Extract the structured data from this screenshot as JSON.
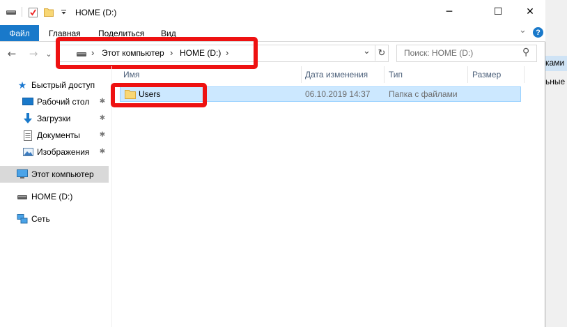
{
  "window": {
    "title": "HOME (D:)",
    "controls": {
      "minimize": "─",
      "maximize": "☐",
      "close": "✕"
    }
  },
  "ribbon": {
    "tabs": [
      "Файл",
      "Главная",
      "Поделиться",
      "Вид"
    ],
    "help_label": "?",
    "expand_label": "⌄"
  },
  "nav": {
    "back": "←",
    "forward": "→",
    "recent": "⌄",
    "up": "↑",
    "address": {
      "separator": "›",
      "crumbs": [
        "Этот компьютер",
        "HOME (D:)"
      ],
      "dropdown": "⌄",
      "refresh": "↻"
    },
    "search_placeholder": "Поиск: HOME (D:)",
    "search_icon_glyph": "⚲"
  },
  "sidebar": {
    "quick_access": "Быстрый доступ",
    "pinned": [
      "Рабочий стол",
      "Загрузки",
      "Документы",
      "Изображения"
    ],
    "this_pc": "Этот компьютер",
    "drive": "HOME (D:)",
    "network": "Сеть",
    "pin_glyph": "✱"
  },
  "columns": [
    "Имя",
    "Дата изменения",
    "Тип",
    "Размер"
  ],
  "files": [
    {
      "name": "Users",
      "modified": "06.10.2019 14:37",
      "type": "Папка с файлами",
      "size": ""
    }
  ],
  "background_window": {
    "labels": [
      "ками",
      "ьные"
    ]
  },
  "colors": {
    "accent": "#1979ca",
    "selection": "#cce8ff",
    "selection_border": "#99d1ff",
    "annotation": "#ee1111",
    "nav_selected": "#d9d9d9",
    "folder": "#f8d775"
  }
}
